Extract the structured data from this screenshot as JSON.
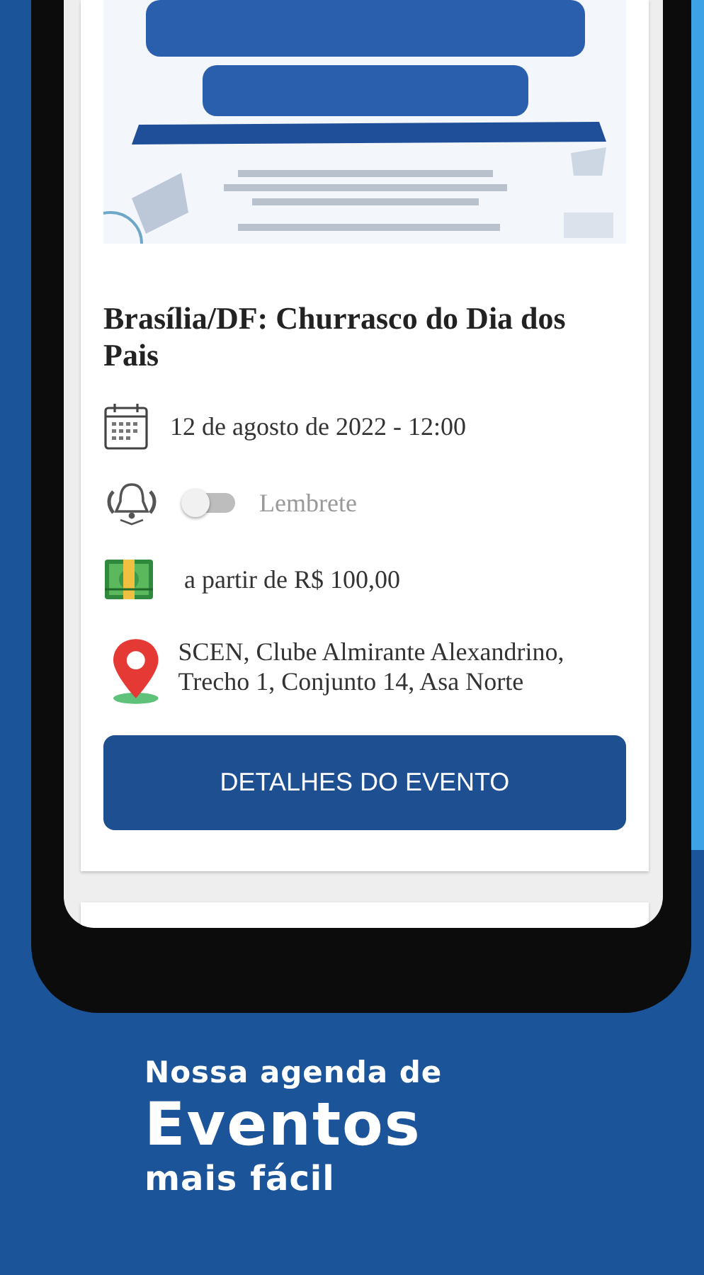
{
  "event": {
    "title": "Brasília/DF: Churrasco do Dia dos Pais",
    "date": "12 de agosto de 2022 - 12:00",
    "reminder": {
      "label": "Lembrete",
      "on": false
    },
    "price": "a partir de R$ 100,00",
    "address": "SCEN, Clube Almirante Alexandrino, Trecho 1, Conjunto 14, Asa Norte",
    "button": "DETALHES DO EVENTO"
  },
  "tagline": {
    "line_1": "Nossa agenda de",
    "line_2": "Eventos",
    "line_3": "mais fácil"
  }
}
